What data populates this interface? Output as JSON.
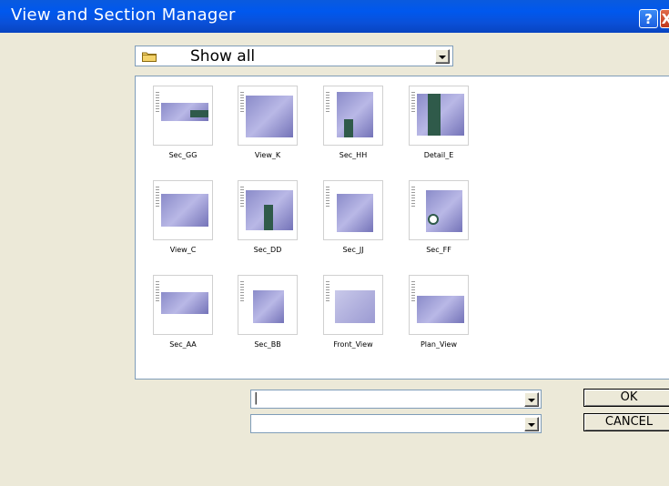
{
  "window": {
    "title": "View and Section  Manager",
    "help_glyph": "?",
    "close_glyph": "X"
  },
  "folder_filter": {
    "selected": "Show all",
    "icon": "folder-icon"
  },
  "thumbnails": [
    {
      "label": "Sec_GG"
    },
    {
      "label": "View_K"
    },
    {
      "label": "Sec_HH"
    },
    {
      "label": "Detail_E"
    },
    {
      "label": "View_C"
    },
    {
      "label": "Sec_DD"
    },
    {
      "label": "Sec_JJ"
    },
    {
      "label": "Sec_FF"
    },
    {
      "label": "Sec_AA"
    },
    {
      "label": "Sec_BB"
    },
    {
      "label": "Front_View"
    },
    {
      "label": "Plan_View"
    }
  ],
  "inputs": {
    "primary_value": "|",
    "secondary_value": ""
  },
  "buttons": {
    "ok": "OK",
    "cancel": "CANCEL"
  },
  "colors": {
    "titlebar": "#0a50d8",
    "dialog_bg": "#ece9d8",
    "part_purple": "#8a8bc9",
    "part_shadow": "#2f5a4a"
  }
}
